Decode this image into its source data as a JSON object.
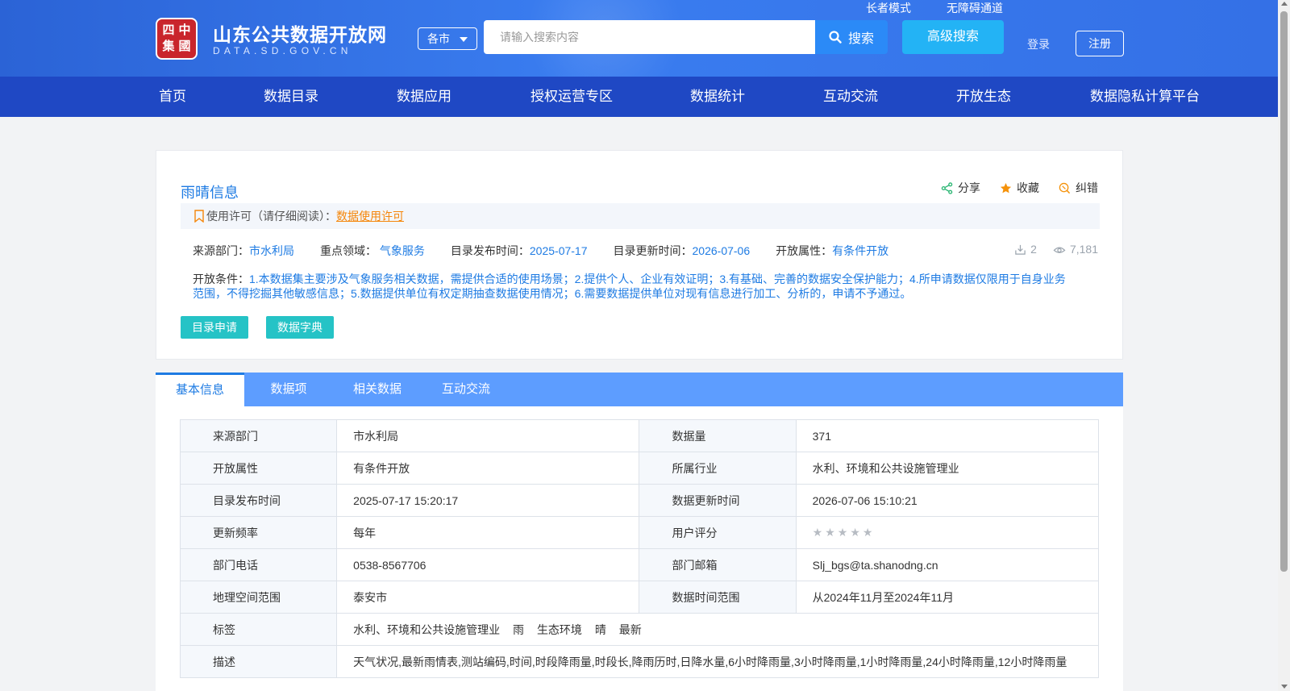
{
  "header": {
    "logo_seal_chars": [
      "中",
      "四",
      "國",
      "集"
    ],
    "site_title": "山东公共数据开放网",
    "site_subtitle": "DATA.SD.GOV.CN",
    "region_select": "各市",
    "search_placeholder": "请输入搜索内容",
    "search_button": "搜索",
    "advanced_search": "高级搜索",
    "elder_mode": "长者模式",
    "accessibility": "无障碍通道",
    "login": "登录",
    "register": "注册"
  },
  "nav": {
    "items": [
      "首页",
      "数据目录",
      "数据应用",
      "授权运营专区",
      "数据统计",
      "互动交流",
      "开放生态",
      "数据隐私计算平台"
    ]
  },
  "dataset": {
    "title": "雨晴信息",
    "actions": {
      "share": "分享",
      "favorite": "收藏",
      "correct": "纠错"
    },
    "license_label": "使用许可（请仔细阅读）：",
    "license_link": "数据使用许可",
    "meta": {
      "source_label": "来源部门：",
      "source_value": "市水利局",
      "domain_label": "重点领域：",
      "domain_value": "气象服务",
      "publish_label": "目录发布时间：",
      "publish_value": "2025-07-17",
      "update_label": "目录更新时间：",
      "update_value": "2026-07-06",
      "open_label": "开放属性：",
      "open_value": "有条件开放"
    },
    "downloads": "2",
    "views": "7,181",
    "conditions_label": "开放条件：",
    "conditions_text": "1.本数据集主要涉及气象服务相关数据，需提供合适的使用场景；2.提供个人、企业有效证明；3.有基础、完善的数据安全保护能力；4.所申请数据仅限用于自身业务范围，不得挖掘其他敏感信息；5.数据提供单位有权定期抽查数据使用情况；6.需要数据提供单位对现有信息进行加工、分析的，申请不予通过。",
    "apply_button": "目录申请",
    "dictionary_button": "数据字典"
  },
  "tabs": [
    "基本信息",
    "数据项",
    "相关数据",
    "互动交流"
  ],
  "info_table": {
    "r1": {
      "k1": "来源部门",
      "v1": "市水利局",
      "k2": "数据量",
      "v2": "371"
    },
    "r2": {
      "k1": "开放属性",
      "v1": "有条件开放",
      "k2": "所属行业",
      "v2": "水利、环境和公共设施管理业"
    },
    "r3": {
      "k1": "目录发布时间",
      "v1": "2025-07-17 15:20:17",
      "k2": "数据更新时间",
      "v2": "2026-07-06 15:10:21"
    },
    "r4": {
      "k1": "更新频率",
      "v1": "每年",
      "k2": "用户评分",
      "rating": 0,
      "rating_max": 5
    },
    "r5": {
      "k1": "部门电话",
      "v1": "0538-8567706",
      "k2": "部门邮箱",
      "v2": "Slj_bgs@ta.shanodng.cn"
    },
    "r6": {
      "k1": "地理空间范围",
      "v1": "泰安市",
      "k2": "数据时间范围",
      "v2": "从2024年11月至2024年11月"
    },
    "r7": {
      "k1": "标签",
      "tags": [
        "水利、环境和公共设施管理业",
        "雨",
        "生态环境",
        "晴",
        "最新"
      ]
    },
    "r8": {
      "k1": "描述",
      "v1": "天气状况,最新雨情表,测站编码,时间,时段降雨量,时段长,降雨历时,日降水量,6小时降雨量,3小时降雨量,1小时降雨量,24小时降雨量,12小时降雨量"
    }
  },
  "colors": {
    "header_bg": "#3470e6",
    "nav_bg": "#1f48c4",
    "link_blue": "#1e7be3",
    "teal_button": "#25c3c6",
    "license_orange": "#f5860a",
    "tab_bar": "#5d9dff"
  }
}
